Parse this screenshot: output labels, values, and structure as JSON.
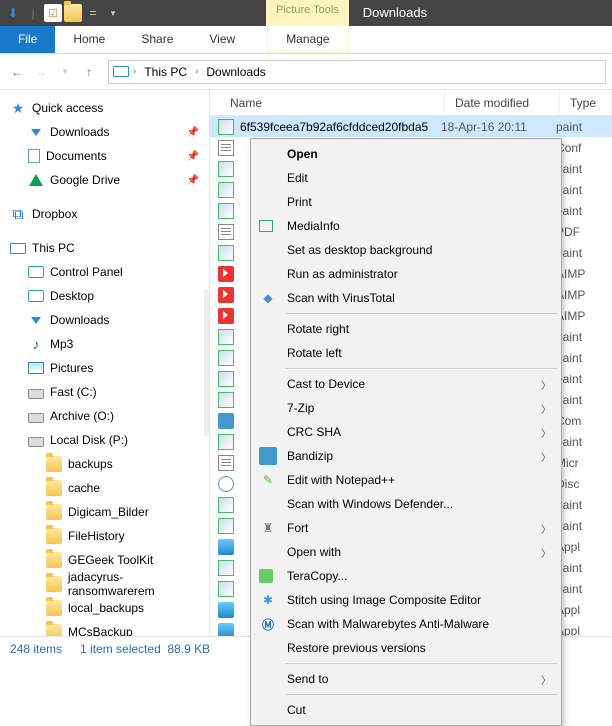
{
  "titlebar": {
    "contextual_label": "Picture Tools",
    "location_label": "Downloads"
  },
  "ribbon": {
    "file": "File",
    "home": "Home",
    "share": "Share",
    "view": "View",
    "manage": "Manage"
  },
  "breadcrumb": {
    "root": "This PC",
    "leaf": "Downloads"
  },
  "tree": {
    "quick_access": "Quick access",
    "downloads": "Downloads",
    "documents": "Documents",
    "google_drive": "Google Drive",
    "dropbox": "Dropbox",
    "this_pc": "This PC",
    "control_panel": "Control Panel",
    "desktop": "Desktop",
    "downloads2": "Downloads",
    "mp3": "Mp3",
    "pictures": "Pictures",
    "fast": "Fast (C:)",
    "archive": "Archive (O:)",
    "local_disk": "Local Disk (P:)",
    "backups": "backups",
    "cache": "cache",
    "digicam": "Digicam_Bilder",
    "filehistory": "FileHistory",
    "gegeek": "GEGeek ToolKit",
    "jadacyrus": "jadacyrus-ransomwarerem",
    "local_backups": "local_backups",
    "mcsbackup": "MCsBackup"
  },
  "columns": {
    "name": "Name",
    "date": "Date modified",
    "type": "Type"
  },
  "rows": {
    "selected_name": "6f539fceea7b92af6cfddced20fbda5",
    "selected_date": "18-Apr-16 20:11",
    "types": [
      "paint",
      "Conf",
      "paint",
      "paint",
      "paint",
      "PDF",
      "paint",
      "AIMP",
      "AIMP",
      "AIMP",
      "paint",
      "paint",
      "paint",
      "paint",
      "Com",
      "paint",
      "Micr",
      "Disc",
      "paint",
      "paint",
      "Appl",
      "paint",
      "paint",
      "Appl",
      "Appl"
    ]
  },
  "ctx": {
    "open": "Open",
    "edit": "Edit",
    "print": "Print",
    "mediainfo": "MediaInfo",
    "set_bg": "Set as desktop background",
    "run_admin": "Run as administrator",
    "scan_vt": "Scan with VirusTotal",
    "rotate_right": "Rotate right",
    "rotate_left": "Rotate left",
    "cast": "Cast to Device",
    "sevenzip": "7-Zip",
    "crc": "CRC SHA",
    "bandizip": "Bandizip",
    "npp": "Edit with Notepad++",
    "defender": "Scan with Windows Defender...",
    "fort": "Fort",
    "open_with": "Open with",
    "teracopy": "TeraCopy...",
    "stitch": "Stitch using Image Composite Editor",
    "mwb": "Scan with Malwarebytes Anti-Malware",
    "restore": "Restore previous versions",
    "send_to": "Send to",
    "cut": "Cut"
  },
  "status": {
    "items": "248 items",
    "selected": "1 item selected",
    "size": "88.9 KB"
  }
}
